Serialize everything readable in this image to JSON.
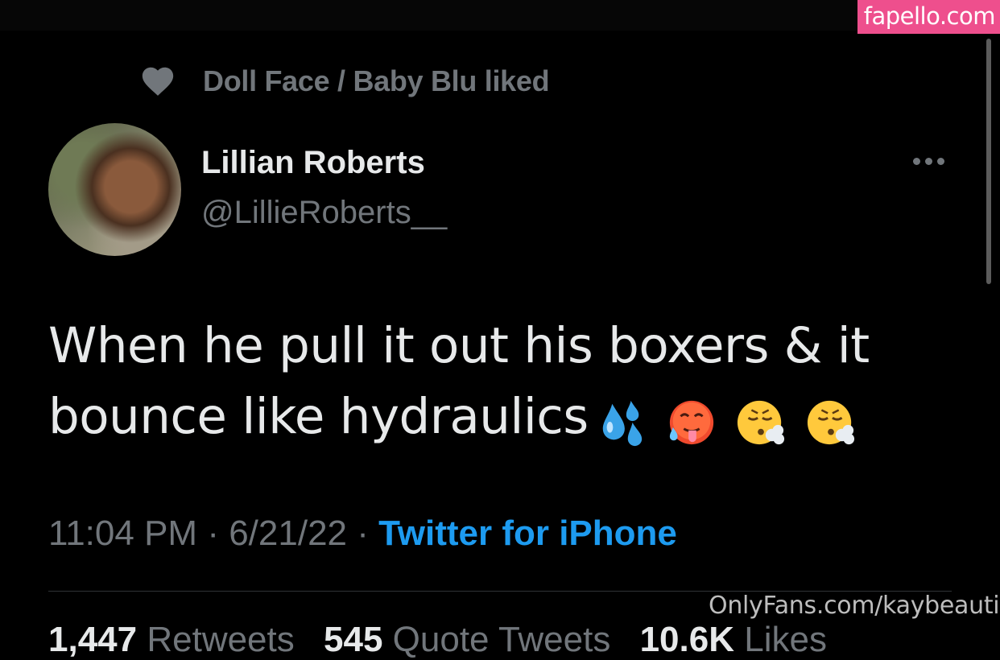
{
  "watermark": "fapello.com",
  "social_context": "Doll Face / Baby Blu liked",
  "author": {
    "name": "Lillian Roberts",
    "handle": "@LillieRoberts__"
  },
  "tweet": {
    "text": "When he pull it out his boxers & it bounce like hydraulics",
    "emojis": [
      "sweat-droplets-icon",
      "hot-face-icon",
      "face-exhaling-icon",
      "face-exhaling-icon"
    ]
  },
  "meta": {
    "time": "11:04 PM",
    "separator": "·",
    "date": "6/21/22",
    "source": "Twitter for iPhone"
  },
  "onlyfans_watermark": "OnlyFans.com/kaybeautiii",
  "stats": {
    "retweets_count": "1,447",
    "retweets_label": "Retweets",
    "quotes_count": "545",
    "quotes_label": "Quote Tweets",
    "likes_count": "10.6K",
    "likes_label": "Likes"
  },
  "colors": {
    "background": "#000000",
    "text_primary": "#e7e9ea",
    "text_secondary": "#71767b",
    "link": "#1d9bf0",
    "watermark_bg": "#ee4f8d"
  }
}
